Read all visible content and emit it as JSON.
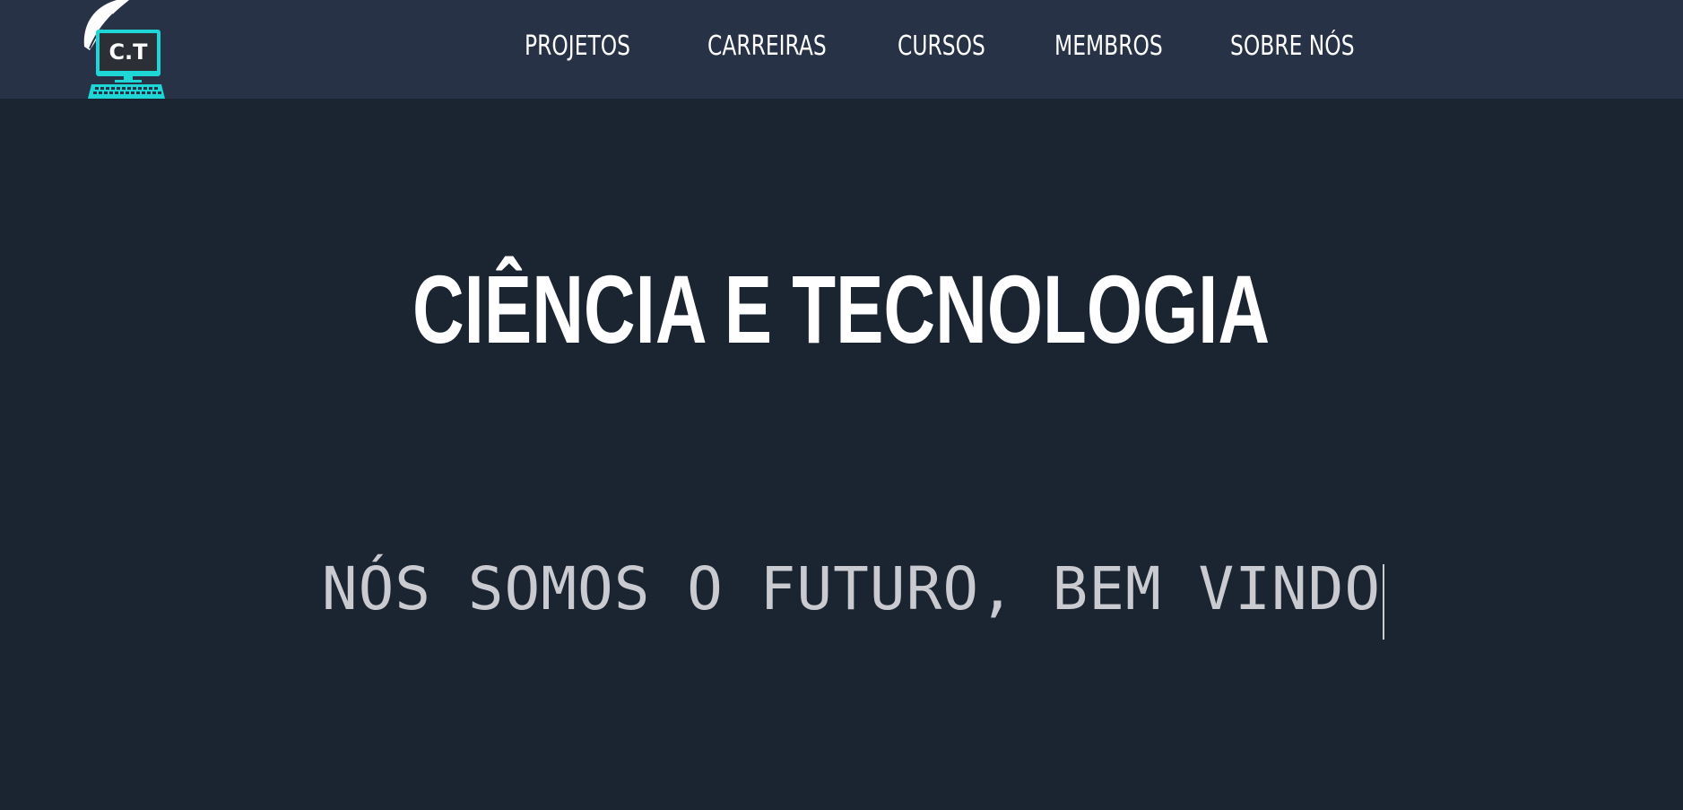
{
  "brand": {
    "logo_text": "C.T",
    "logo_icon": "monitor-keyboard-leaf-logo",
    "accent_color": "#1fd6d6"
  },
  "nav": {
    "items": [
      {
        "label": "PROJETOS"
      },
      {
        "label": "CARREIRAS"
      },
      {
        "label": "CURSOS"
      },
      {
        "label": "MEMBROS"
      },
      {
        "label": "SOBRE NÓS"
      }
    ]
  },
  "hero": {
    "title": "CIÊNCIA E TECNOLOGIA",
    "typing_text": "NÓS SOMOS O FUTURO, BEM VINDO"
  },
  "colors": {
    "navbar_bg": "#283247",
    "page_bg": "#1b2431",
    "title_color": "#ffffff",
    "typing_color": "#c9cbd1"
  }
}
